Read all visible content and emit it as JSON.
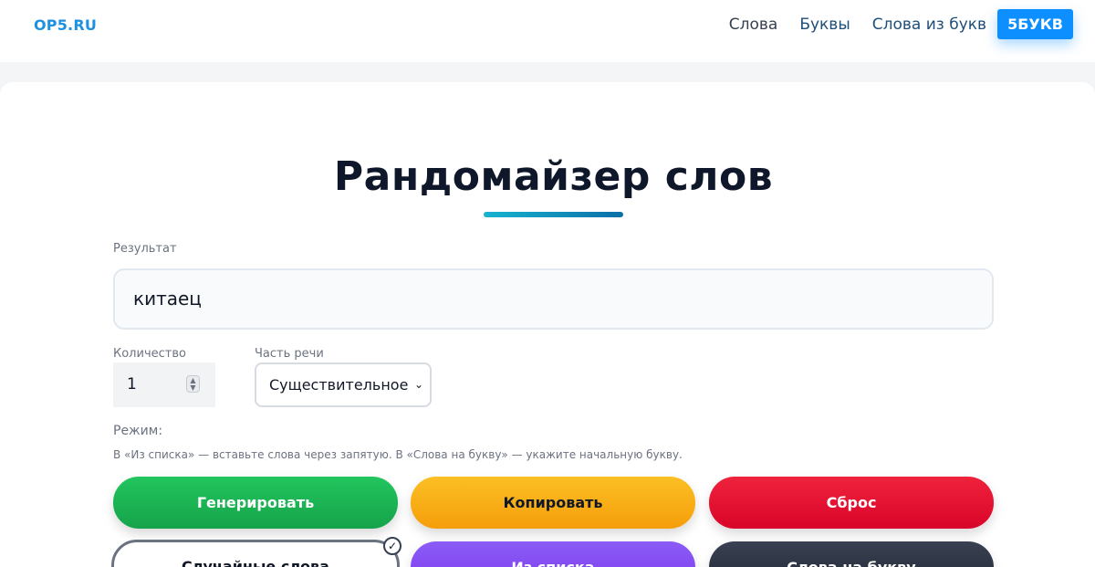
{
  "header": {
    "logo": "OP5.RU",
    "nav": {
      "words": "Слова",
      "letters": "Буквы",
      "words_from_letters": "Слова из букв",
      "brand": "5БУКВ"
    }
  },
  "main": {
    "title": "Рандомайзер слов",
    "result_label": "Результат",
    "result_value": "китаец",
    "quantity_label": "Количество",
    "quantity_value": "1",
    "pos_label": "Часть речи",
    "pos_value": "Существительное",
    "mode_label": "Режим:",
    "hint": "В «Из списка» — вставьте слова через запятую. В «Слова на букву» — укажите начальную букву.",
    "buttons": {
      "generate": "Генерировать",
      "copy": "Копировать",
      "reset": "Сброс",
      "mode_random": "Случайные слова",
      "mode_list": "Из списка",
      "mode_letter": "Слова на букву"
    }
  },
  "colors": {
    "accent": "#0d8fff",
    "generate": "#22c55e",
    "copy": "#f59e0b",
    "reset": "#d90429",
    "list": "#7c3aed",
    "letter": "#1f2937"
  }
}
